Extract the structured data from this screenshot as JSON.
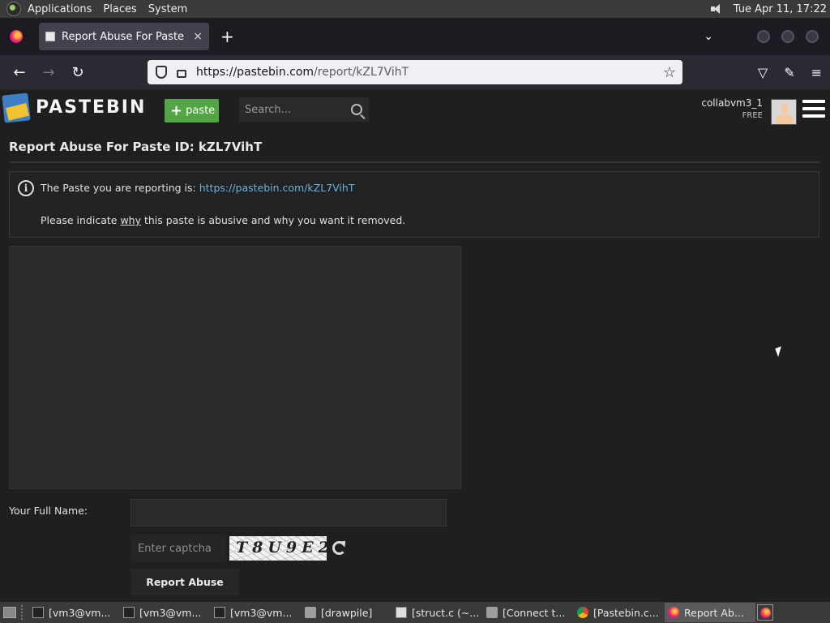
{
  "top_panel": {
    "menus": [
      "Applications",
      "Places",
      "System"
    ],
    "clock": "Tue Apr 11, 17:22"
  },
  "browser": {
    "tab_title": "Report Abuse For Paste ID:",
    "tab_close": "×",
    "new_tab": "+",
    "url_host": "https://pastebin.com",
    "url_path": "/report/kZL7VihT"
  },
  "site": {
    "brand": "PASTEBIN",
    "paste_button": "paste",
    "search_placeholder": "Search...",
    "username": "collabvm3_1",
    "plan": "FREE"
  },
  "report": {
    "title": "Report Abuse For Paste ID: kZL7VihT",
    "info_prefix": "The Paste you are reporting is: ",
    "paste_link": "https://pastebin.com/kZL7VihT",
    "instruction_prefix": "Please indicate ",
    "instruction_underlined": "why",
    "instruction_suffix": " this paste is abusive and why you want it removed.",
    "name_label": "Your Full Name:",
    "name_value": "",
    "captcha_placeholder": "Enter captcha",
    "captcha_code": "T8U9E2",
    "submit_label": "Report Abuse"
  },
  "taskbar": {
    "tasks": [
      {
        "label": "[vm3@vm...",
        "icon": "terminal-icon"
      },
      {
        "label": "[vm3@vm...",
        "icon": "terminal-icon"
      },
      {
        "label": "[vm3@vm...",
        "icon": "terminal-icon"
      },
      {
        "label": "[drawpile]",
        "icon": "folder-icon"
      },
      {
        "label": "[struct.c (~...",
        "icon": "text-editor-icon"
      },
      {
        "label": "[Connect t...",
        "icon": "folder-icon"
      },
      {
        "label": "[Pastebin.c...",
        "icon": "chrome-icon"
      },
      {
        "label": "Report Ab...",
        "icon": "firefox-icon"
      }
    ]
  }
}
